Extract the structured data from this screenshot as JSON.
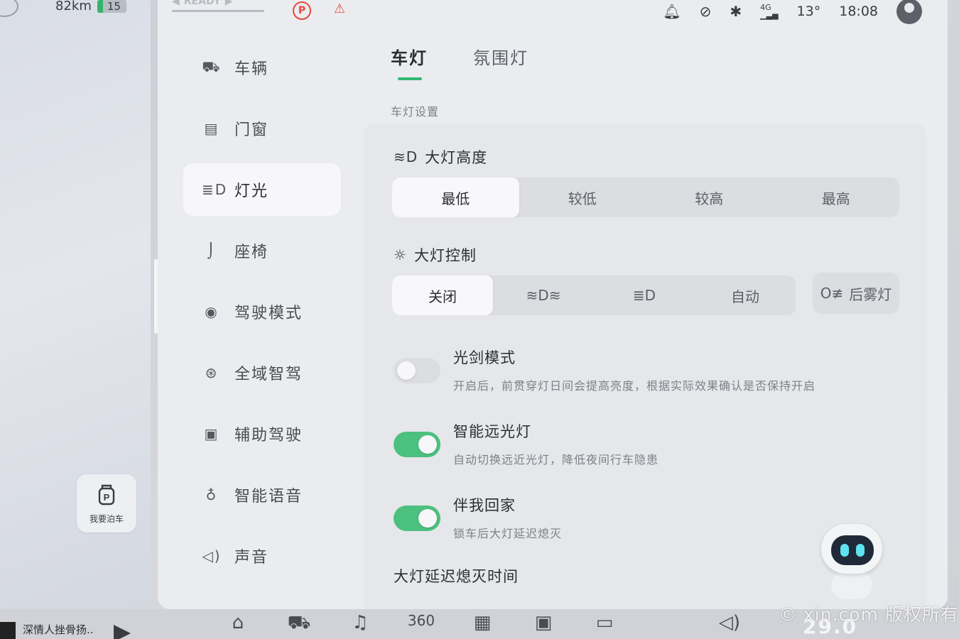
{
  "left_panel": {
    "range": "82km",
    "battery_level": "15",
    "park_button_label": "我要泊车"
  },
  "status_bar": {
    "gear_label": "READY",
    "signal": "4G",
    "temperature": "13°",
    "time": "18:08"
  },
  "nav": {
    "items": [
      {
        "label": "车辆",
        "icon": "car-icon",
        "glyph": "⛟"
      },
      {
        "label": "门窗",
        "icon": "door-icon",
        "glyph": "▤"
      },
      {
        "label": "灯光",
        "icon": "headlight-icon",
        "glyph": "≣D",
        "active": true
      },
      {
        "label": "座椅",
        "icon": "seat-icon",
        "glyph": "⌡"
      },
      {
        "label": "驾驶模式",
        "icon": "steering-wheel-icon",
        "glyph": "◉"
      },
      {
        "label": "全域智驾",
        "icon": "smart-drive-icon",
        "glyph": "⊛"
      },
      {
        "label": "辅助驾驶",
        "icon": "assist-drive-icon",
        "glyph": "▣"
      },
      {
        "label": "智能语音",
        "icon": "microphone-icon",
        "glyph": "♁"
      },
      {
        "label": "声音",
        "icon": "speaker-icon",
        "glyph": "◁)"
      }
    ]
  },
  "tabs": [
    "车灯",
    "氛围灯"
  ],
  "section_label": "车灯设置",
  "headlight_height": {
    "title": "大灯高度",
    "options": [
      "最低",
      "较低",
      "较高",
      "最高"
    ],
    "selected": "最低"
  },
  "headlight_control": {
    "title": "大灯控制",
    "options": [
      "关闭",
      "",
      "",
      "自动"
    ],
    "option_icons": [
      "",
      "parking-light-icon",
      "low-beam-icon",
      ""
    ],
    "selected": "关闭",
    "fog_label": "后雾灯"
  },
  "toggles": [
    {
      "title": "光剑模式",
      "desc": "开启后，前贯穿灯日间会提高亮度，根据实际效果确认是否保持开启",
      "on": false
    },
    {
      "title": "智能远光灯",
      "desc": "自动切换远近光灯，降低夜间行车隐患",
      "on": true
    },
    {
      "title": "伴我回家",
      "desc": "锁车后大灯延迟熄灭",
      "on": true
    }
  ],
  "delay_title": "大灯延迟熄灭时间",
  "dock": {
    "song": "深情人挫骨扬..",
    "icon_360": "360",
    "temperature": "29.0"
  },
  "watermark": "© xin.com 版权所有",
  "colors": {
    "accent_green": "#32b873",
    "toggle_on": "#4cc07e",
    "warning_red": "#e8473e"
  }
}
